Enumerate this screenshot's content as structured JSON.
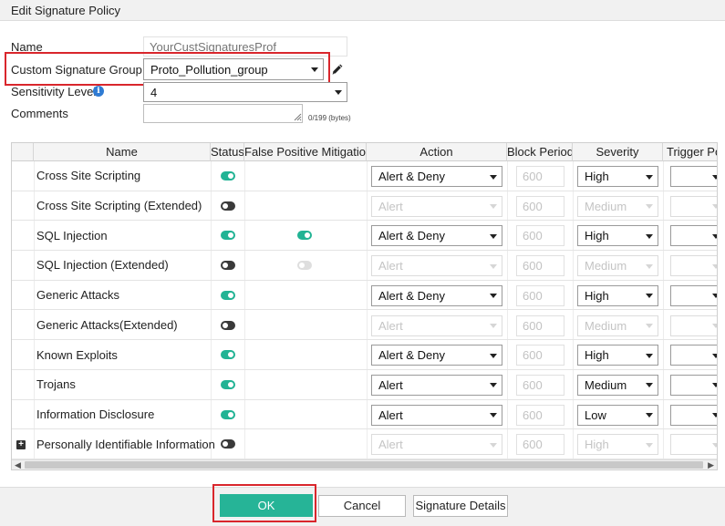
{
  "dialog": {
    "title": "Edit Signature Policy"
  },
  "form": {
    "name_label": "Name",
    "name_placeholder": "YourCustSignaturesProf",
    "group_label": "Custom Signature Group",
    "group_value": "Proto_Pollution_group",
    "sensitivity_label": "Sensitivity Level",
    "sensitivity_value": "4",
    "comments_label": "Comments",
    "comments_counter": "0/199 (bytes)"
  },
  "table": {
    "headers": [
      "Name",
      "Status",
      "False Positive Mitigation",
      "Action",
      "Block Period",
      "Severity",
      "Trigger Pol"
    ],
    "rows": [
      {
        "name": "Cross Site Scripting",
        "status": "on",
        "fpm": "",
        "action": "Alert & Deny",
        "action_enabled": true,
        "block_period": "600",
        "severity": "High",
        "severity_enabled": true
      },
      {
        "name": "Cross Site Scripting (Extended)",
        "status": "off",
        "fpm": "",
        "action": "Alert",
        "action_enabled": false,
        "block_period": "600",
        "severity": "Medium",
        "severity_enabled": false
      },
      {
        "name": "SQL Injection",
        "status": "on",
        "fpm": "on",
        "action": "Alert & Deny",
        "action_enabled": true,
        "block_period": "600",
        "severity": "High",
        "severity_enabled": true
      },
      {
        "name": "SQL Injection (Extended)",
        "status": "off",
        "fpm": "dim",
        "action": "Alert",
        "action_enabled": false,
        "block_period": "600",
        "severity": "Medium",
        "severity_enabled": false
      },
      {
        "name": "Generic Attacks",
        "status": "on",
        "fpm": "",
        "action": "Alert & Deny",
        "action_enabled": true,
        "block_period": "600",
        "severity": "High",
        "severity_enabled": true
      },
      {
        "name": "Generic Attacks(Extended)",
        "status": "off",
        "fpm": "",
        "action": "Alert",
        "action_enabled": false,
        "block_period": "600",
        "severity": "Medium",
        "severity_enabled": false
      },
      {
        "name": "Known Exploits",
        "status": "on",
        "fpm": "",
        "action": "Alert & Deny",
        "action_enabled": true,
        "block_period": "600",
        "severity": "High",
        "severity_enabled": true
      },
      {
        "name": "Trojans",
        "status": "on",
        "fpm": "",
        "action": "Alert",
        "action_enabled": true,
        "block_period": "600",
        "severity": "Medium",
        "severity_enabled": true
      },
      {
        "name": "Information Disclosure",
        "status": "on",
        "fpm": "",
        "action": "Alert",
        "action_enabled": true,
        "block_period": "600",
        "severity": "Low",
        "severity_enabled": true
      },
      {
        "name": "Personally Identifiable Information",
        "status": "off",
        "fpm": "",
        "action": "Alert",
        "action_enabled": false,
        "block_period": "600",
        "severity": "High",
        "severity_enabled": false,
        "expandable": true
      }
    ]
  },
  "footer": {
    "ok_label": "OK",
    "cancel_label": "Cancel",
    "details_label": "Signature Details"
  },
  "colors": {
    "accent": "#26b497",
    "highlight": "#d9262c"
  }
}
